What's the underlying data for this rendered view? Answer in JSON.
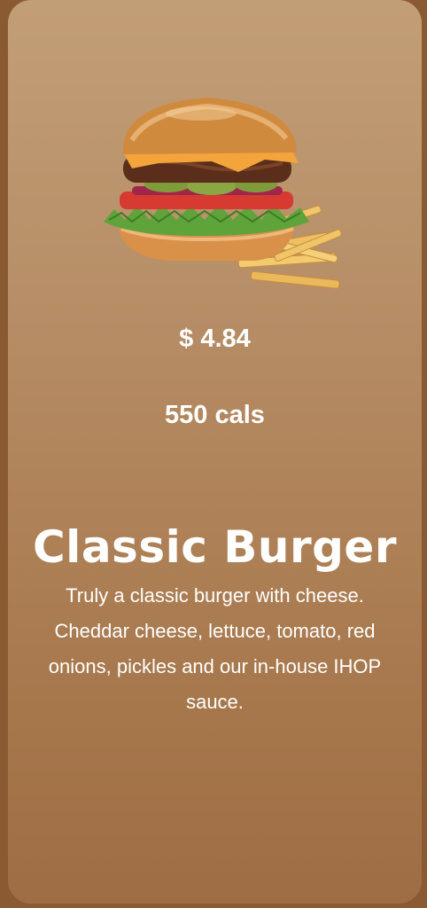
{
  "item": {
    "price": "$ 4.84",
    "calories": "550 cals",
    "name": "Classic Burger",
    "description": "Truly a classic burger with cheese. Cheddar cheese, lettuce, tomato, red onions, pickles and our in-house IHOP sauce."
  },
  "colors": {
    "page_background": "#8a5a33",
    "card_gradient_top": "#c29e76",
    "card_gradient_bottom": "#9f6d43",
    "text": "#ffffff"
  },
  "icons": {
    "food_image": "burger-with-fries-image"
  }
}
